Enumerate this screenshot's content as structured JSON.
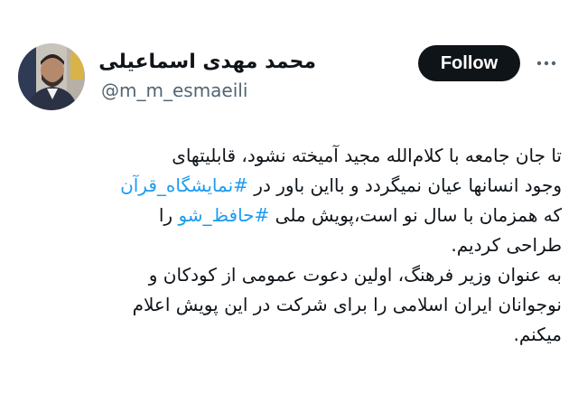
{
  "author": {
    "display_name": "محمد مهدی اسماعیلی",
    "handle": "@m_m_esmaeili",
    "avatar_icon": "profile-photo"
  },
  "actions": {
    "follow_label": "Follow",
    "more_icon": "more-horizontal-icon"
  },
  "tweet": {
    "line1": "تا جان جامعه با کلام‌الله مجید آمیخته نشود، قابلیتهای",
    "line2_before": "وجود انسانها عیان نمیگردد و بااین باور در ",
    "hashtag_1": "#نمایشگاه_قرآن",
    "line3_before": "که همزمان با سال نو است،پویش ملی ",
    "hashtag_2": "#حافظ_شو",
    "line3_after": " را",
    "line4": "طراحی کردیم.",
    "line5": "به عنوان وزیر فرهنگ، اولین دعوت عمومی از کودکان و",
    "line6": "نوجوانان ایران اسلامی را برای شرکت در این پویش اعلام",
    "line7": "میکنم."
  },
  "colors": {
    "link": "#1d9bf0",
    "text": "#0f1419",
    "secondary": "#536471",
    "button_bg": "#0f1419"
  }
}
